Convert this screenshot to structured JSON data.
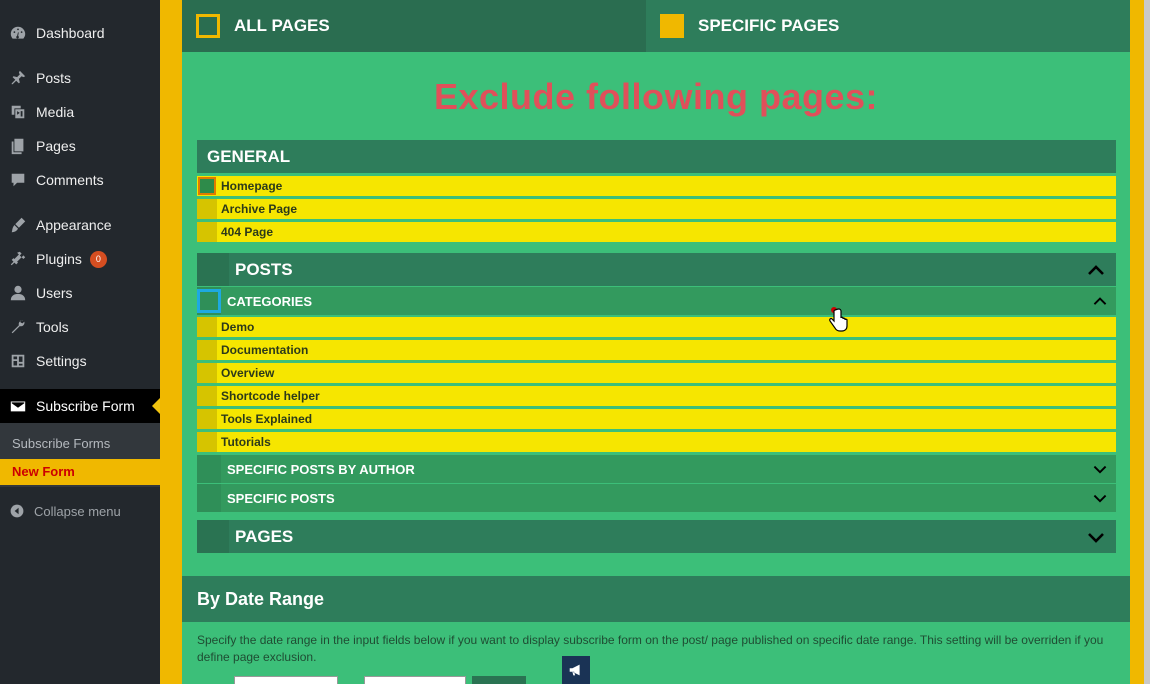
{
  "sidebar": {
    "items": [
      {
        "label": "Dashboard",
        "icon": "dashboard-icon"
      },
      {
        "label": "Posts",
        "icon": "pushpin-icon"
      },
      {
        "label": "Media",
        "icon": "media-icon"
      },
      {
        "label": "Pages",
        "icon": "pages-icon"
      },
      {
        "label": "Comments",
        "icon": "comment-icon"
      },
      {
        "label": "Appearance",
        "icon": "brush-icon"
      },
      {
        "label": "Plugins",
        "icon": "plugin-icon",
        "badge": "0"
      },
      {
        "label": "Users",
        "icon": "user-icon"
      },
      {
        "label": "Tools",
        "icon": "wrench-icon"
      },
      {
        "label": "Settings",
        "icon": "settings-icon"
      },
      {
        "label": "Subscribe Form",
        "icon": "envelope-icon"
      }
    ],
    "submenu": [
      "Subscribe Forms",
      "New Form"
    ],
    "collapse_label": "Collapse menu"
  },
  "tabs": {
    "all_pages": "ALL PAGES",
    "specific_pages": "SPECIFIC PAGES"
  },
  "heading": "Exclude following pages:",
  "general": {
    "title": "GENERAL",
    "items": [
      "Homepage",
      "Archive Page",
      "404 Page"
    ]
  },
  "posts": {
    "title": "POSTS",
    "categories": {
      "title": "CATEGORIES",
      "items": [
        "Demo",
        "Documentation",
        "Overview",
        "Shortcode helper",
        "Tools Explained",
        "Tutorials"
      ]
    },
    "by_author": "SPECIFIC POSTS BY AUTHOR",
    "specific_posts": "SPECIFIC POSTS"
  },
  "pages_section": {
    "title": "PAGES"
  },
  "date_range": {
    "title": "By Date Range",
    "description": "Specify the date range in the input fields below if you want to display subscribe form on the post/ page published on specific date range. This setting will be overriden if you define page exclusion."
  },
  "colors": {
    "accent_yellow": "#f0b800",
    "panel_green": "#3cbf79",
    "header_green": "#2e7d5b",
    "row_yellow": "#f6e600",
    "heading_red": "#e0505a"
  }
}
